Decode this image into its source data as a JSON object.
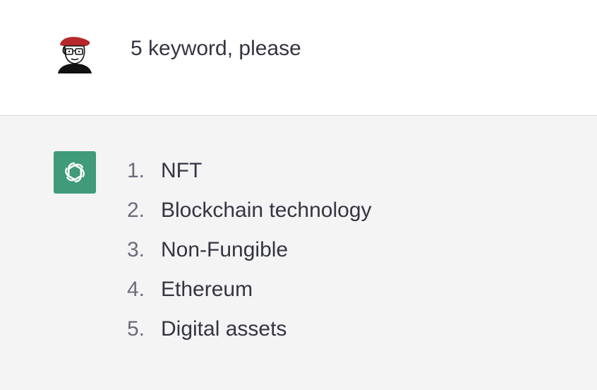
{
  "user_message": {
    "avatar_icon": "user-avatar-cartoon-icon",
    "text": "5 keyword, please"
  },
  "assistant_message": {
    "avatar_icon": "openai-logo-icon",
    "avatar_color": "#3f9b7a",
    "items": [
      {
        "number": "1.",
        "text": "NFT"
      },
      {
        "number": "2.",
        "text": "Blockchain technology"
      },
      {
        "number": "3.",
        "text": "Non-Fungible"
      },
      {
        "number": "4.",
        "text": "Ethereum"
      },
      {
        "number": "5.",
        "text": "Digital assets"
      }
    ]
  }
}
